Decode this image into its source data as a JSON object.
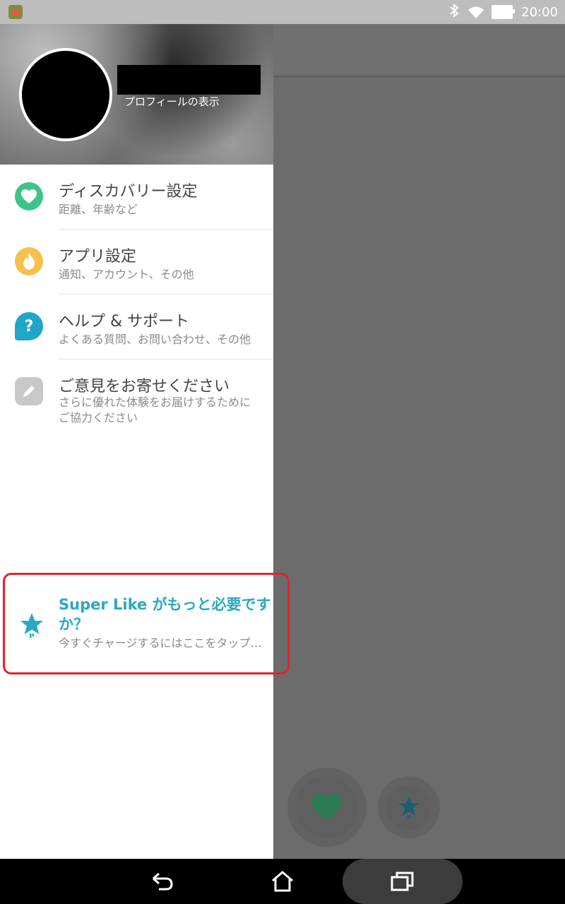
{
  "status_bar": {
    "time": "20:00",
    "icons": [
      "android-app-icon",
      "bluetooth-icon",
      "wifi-icon",
      "battery-icon"
    ]
  },
  "drawer": {
    "header": {
      "profile_link": "プロフィールの表示"
    },
    "menu": [
      {
        "title": "ディスカバリー設定",
        "subtitle": "距離、年齢など",
        "icon": "heart-icon",
        "color": "#3dc48a"
      },
      {
        "title": "アプリ設定",
        "subtitle": "通知、アカウント、その他",
        "icon": "flame-icon",
        "color": "#f7c04a"
      },
      {
        "title": "ヘルプ & サポート",
        "subtitle": "よくある質問、お問い合わせ、その他",
        "icon": "question-icon",
        "color": "#21a6c7"
      },
      {
        "title": "ご意見をお寄せください",
        "subtitle_line1": "さらに優れた体験をお届けするために",
        "subtitle_line2": "ご協力ください",
        "icon": "pencil-icon",
        "color": "#c8c8c8"
      }
    ],
    "superlike": {
      "title": "Super Like がもっと必要ですか？",
      "subtitle": "今すぐチャージするにはここをタップ…",
      "icon": "star-icon",
      "color": "#2aa8c2"
    }
  },
  "actions": {
    "like_icon": "heart-icon",
    "superlike_icon": "star-icon"
  },
  "nav_bar": {
    "buttons": [
      "back-icon",
      "home-icon",
      "recents-icon"
    ]
  }
}
